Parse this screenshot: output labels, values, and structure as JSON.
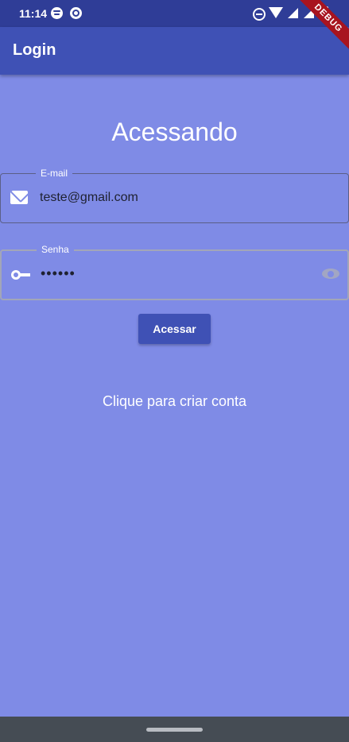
{
  "status_bar": {
    "time": "11:14",
    "icons": [
      "spotify-icon",
      "sync-icon",
      "do-not-disturb-icon",
      "wifi-icon",
      "signal-icon",
      "signal-icon",
      "battery-icon"
    ]
  },
  "debug_banner": "DEBUG",
  "app_bar": {
    "title": "Login"
  },
  "main": {
    "heading": "Acessando",
    "email": {
      "label": "E-mail",
      "value": "teste@gmail.com",
      "icon": "mail-icon"
    },
    "password": {
      "label": "Senha",
      "value": "••••••",
      "icon": "key-icon",
      "toggle_icon": "eye-icon"
    },
    "login_button": "Acessar",
    "create_account": "Clique para criar conta"
  },
  "colors": {
    "background": "#7f8be6",
    "app_bar": "#3f51b5",
    "status_bar": "#2f3d97",
    "nav_bar": "#454c54",
    "debug_banner": "#a8141f"
  }
}
